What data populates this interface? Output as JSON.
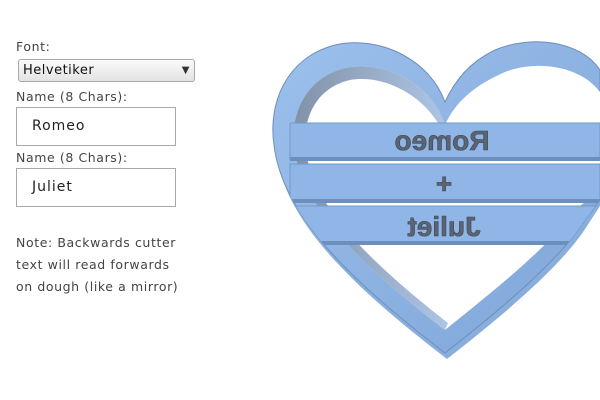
{
  "form": {
    "font_label": "Font:",
    "font_value": "Helvetiker",
    "name1_label": "Name (8 Chars):",
    "name1_value": "Romeo",
    "name2_label": "Name (8 Chars):",
    "name2_value": "Juliet",
    "note_lines": [
      "Note: Backwards cutter",
      "text will read forwards",
      "on dough (like a mirror)"
    ]
  },
  "preview": {
    "line1": "Romeo",
    "line2": "+",
    "line3": "Juliet",
    "shape": "heart",
    "fill_color": "#8fb6e6",
    "edge_color": "#6d8fbd",
    "text_color": "#5a6472"
  }
}
